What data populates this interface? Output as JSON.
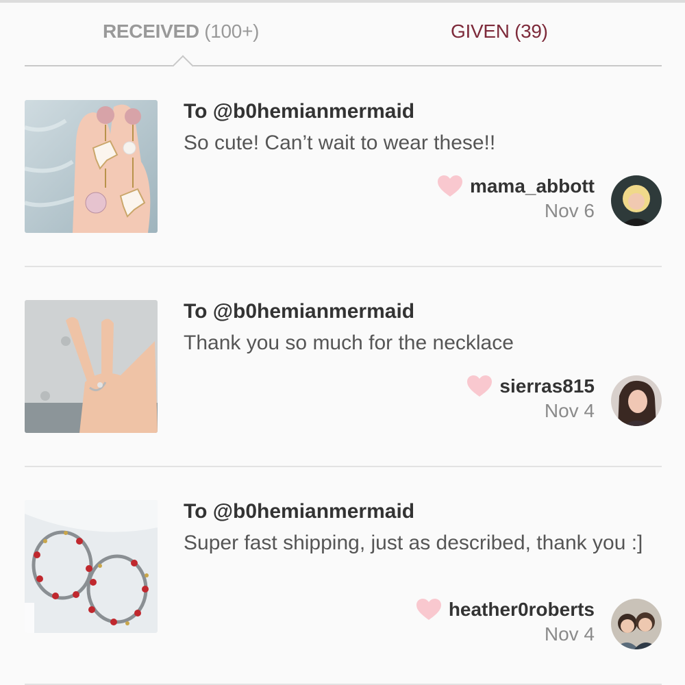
{
  "tabs": {
    "received_label": "RECEIVED",
    "received_count": "(100+)",
    "given_label": "GIVEN (39)"
  },
  "colors": {
    "given_tab": "#7d2a3a",
    "heart": "#f9c8cf",
    "divider": "#e2e2e2"
  },
  "reviews": [
    {
      "to": "To @b0hemianmermaid",
      "message": "So cute! Can’t wait to wear these!!",
      "sender": "mama_abbott",
      "date": "Nov 6",
      "icon": "heart-icon"
    },
    {
      "to": "To @b0hemianmermaid",
      "message": "Thank you so much for the necklace",
      "sender": "sierras815",
      "date": "Nov 4",
      "icon": "heart-icon"
    },
    {
      "to": "To @b0hemianmermaid",
      "message": "Super fast shipping, just as described, thank you :]",
      "sender": "heather0roberts",
      "date": "Nov 4",
      "icon": "heart-icon"
    }
  ]
}
